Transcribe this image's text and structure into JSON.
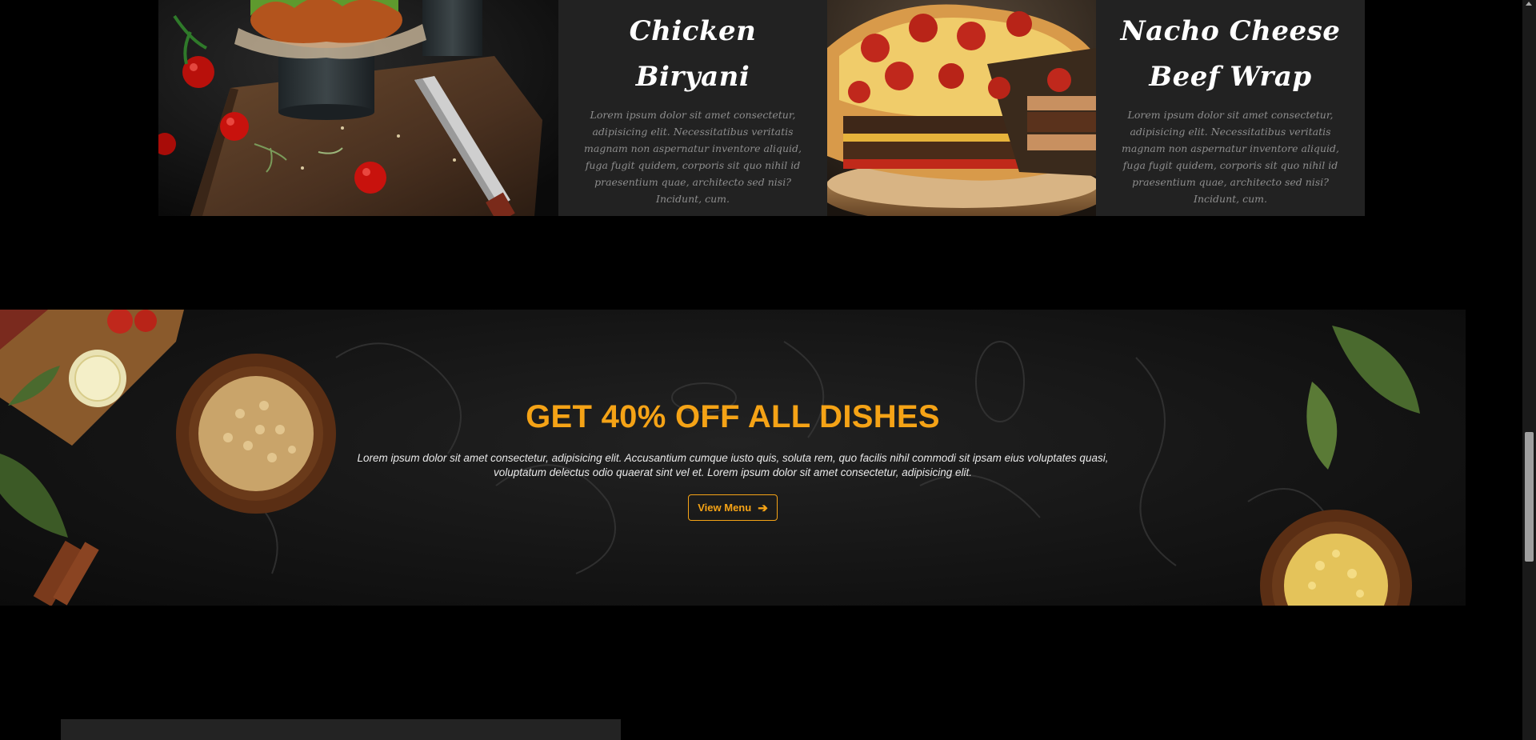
{
  "menu_row": {
    "items": [
      {
        "title_line1": "Chicken Biryani",
        "title_line2": "",
        "description": "Lorem ipsum dolor sit amet consectetur, adipisicing elit. Necessitatibus veritatis magnam non aspernatur inventore aliquid, fuga fugit quidem, corporis sit quo nihil id praesentium quae, architecto sed nisi? Incidunt, cum."
      },
      {
        "title_line1": "Nacho Cheese",
        "title_line2": "Beef Wrap",
        "description": "Lorem ipsum dolor sit amet consectetur, adipisicing elit. Necessitatibus veritatis magnam non aspernatur inventore aliquid, fuga fugit quidem, corporis sit quo nihil id praesentium quae, architecto sed nisi? Incidunt, cum."
      }
    ],
    "images": [
      {
        "icon": "burger-photo"
      },
      {
        "icon": "pizza-burger-photo"
      }
    ]
  },
  "promo": {
    "title": "GET 40% OFF ALL DISHES",
    "text": "Lorem ipsum dolor sit amet consectetur, adipisicing elit. Accusantium cumque iusto quis, soluta rem, quo facilis nihil commodi sit ipsam eius voluptates quasi, voluptatum delectus odio quaerat sint vel et. Lorem ipsum dolor sit amet consectetur, adipisicing elit.",
    "button_label": "View Menu",
    "button_icon": "arrow-right-icon",
    "accent_color": "#f5a316"
  },
  "colors": {
    "page_bg": "#000000",
    "card_bg": "#222222",
    "description_text": "#8d8d8d"
  }
}
